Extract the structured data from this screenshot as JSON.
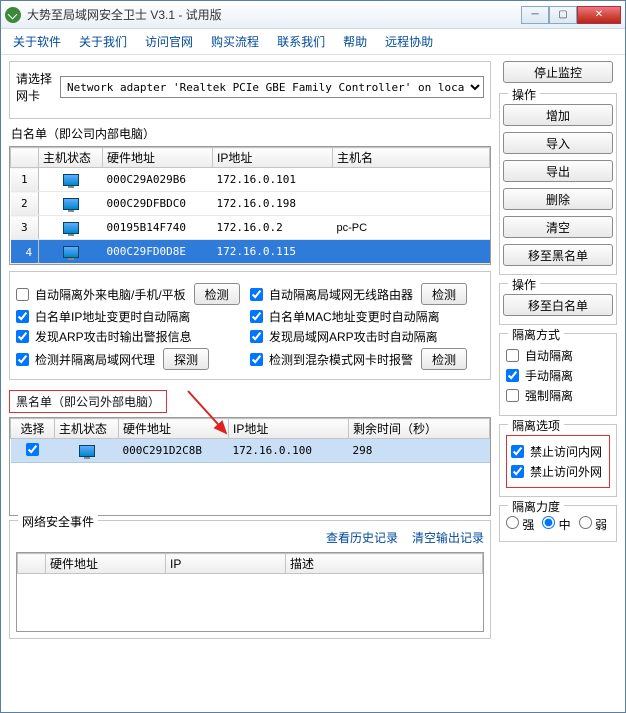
{
  "window": {
    "title": "大势至局域网安全卫士 V3.1 - 试用版"
  },
  "menu": [
    "关于软件",
    "关于我们",
    "访问官网",
    "购买流程",
    "联系我们",
    "帮助",
    "远程协助"
  ],
  "nic": {
    "label": "请选择网卡",
    "selected": "Network adapter 'Realtek PCIe GBE Family Controller' on loca",
    "stop_btn": "停止监控"
  },
  "whitelist": {
    "title": "白名单（即公司内部电脑）",
    "headers": [
      "",
      "主机状态",
      "硬件地址",
      "IP地址",
      "主机名"
    ],
    "rows": [
      {
        "n": "1",
        "mac": "000C29A029B6",
        "ip": "172.16.0.101",
        "host": ""
      },
      {
        "n": "2",
        "mac": "000C29DFBDC0",
        "ip": "172.16.0.198",
        "host": ""
      },
      {
        "n": "3",
        "mac": "00195B14F740",
        "ip": "172.16.0.2",
        "host": "pc-PC"
      },
      {
        "n": "4",
        "mac": "000C29FD0D8E",
        "ip": "172.16.0.115",
        "host": "",
        "sel": true
      }
    ]
  },
  "ops1": {
    "title": "操作",
    "btns": [
      "增加",
      "导入",
      "导出",
      "删除",
      "清空",
      "移至黑名单"
    ]
  },
  "options": {
    "left": [
      {
        "label": "自动隔离外来电脑/手机/平板",
        "checked": false,
        "btn": "检测"
      },
      {
        "label": "白名单IP地址变更时自动隔离",
        "checked": true
      },
      {
        "label": "发现ARP攻击时输出警报信息",
        "checked": true
      },
      {
        "label": "检测并隔离局域网代理",
        "checked": true,
        "btn": "探测"
      }
    ],
    "right": [
      {
        "label": "自动隔离局域网无线路由器",
        "checked": true,
        "btn": "检测"
      },
      {
        "label": "白名单MAC地址变更时自动隔离",
        "checked": true
      },
      {
        "label": "发现局域网ARP攻击时自动隔离",
        "checked": true
      },
      {
        "label": "检测到混杂模式网卡时报警",
        "checked": true,
        "btn": "检测"
      }
    ]
  },
  "blacklist": {
    "title": "黑名单（即公司外部电脑）",
    "headers": [
      "选择",
      "主机状态",
      "硬件地址",
      "IP地址",
      "剩余时间（秒）"
    ],
    "rows": [
      {
        "mac": "000C291D2C8B",
        "ip": "172.16.0.100",
        "time": "298",
        "checked": true
      }
    ]
  },
  "ops2": {
    "title": "操作",
    "btn": "移至白名单"
  },
  "iso_mode": {
    "title": "隔离方式",
    "items": [
      {
        "label": "自动隔离",
        "checked": false
      },
      {
        "label": "手动隔离",
        "checked": true
      },
      {
        "label": "强制隔离",
        "checked": false
      }
    ]
  },
  "iso_opt": {
    "title": "隔离选项",
    "items": [
      {
        "label": "禁止访问内网",
        "checked": true
      },
      {
        "label": "禁止访问外网",
        "checked": true
      }
    ]
  },
  "iso_strength": {
    "title": "隔离力度",
    "options": [
      "强",
      "中",
      "弱"
    ],
    "selected": "中"
  },
  "events": {
    "title": "网络安全事件",
    "links": [
      "查看历史记录",
      "清空输出记录"
    ],
    "headers": [
      "",
      "硬件地址",
      "IP",
      "描述"
    ]
  }
}
